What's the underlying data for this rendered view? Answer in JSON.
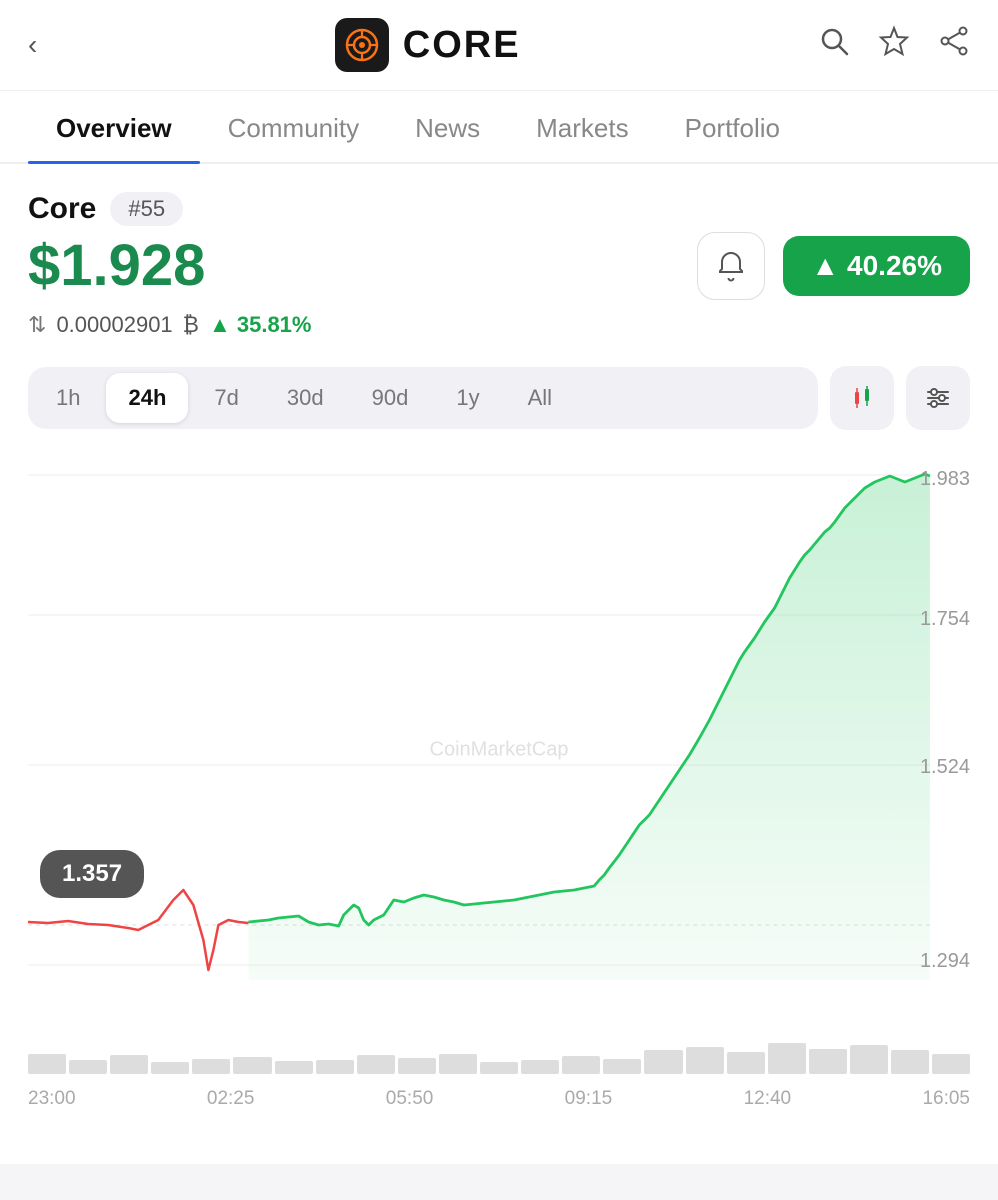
{
  "header": {
    "back_label": "‹",
    "logo_alt": "Core logo",
    "title": "CORE",
    "search_icon": "search",
    "star_icon": "star",
    "share_icon": "share"
  },
  "nav": {
    "tabs": [
      {
        "label": "Overview",
        "active": true
      },
      {
        "label": "Community",
        "active": false
      },
      {
        "label": "News",
        "active": false
      },
      {
        "label": "Markets",
        "active": false
      },
      {
        "label": "Portfolio",
        "active": false
      }
    ]
  },
  "coin": {
    "name": "Core",
    "rank": "#55",
    "price": "$1.928",
    "change_24h": "▲ 40.26%",
    "btc_price": "0.00002901",
    "btc_symbol": "₿",
    "btc_change": "▲ 35.81%"
  },
  "time_filters": [
    "1h",
    "24h",
    "7d",
    "30d",
    "90d",
    "1y",
    "All"
  ],
  "active_filter": "24h",
  "chart": {
    "y_labels": [
      "1.983",
      "1.754",
      "1.524",
      "1.294"
    ],
    "x_labels": [
      "23:00",
      "02:25",
      "05:50",
      "09:15",
      "12:40",
      "16:05"
    ],
    "tooltip": "1.357",
    "watermark": "CoinMarketCap"
  },
  "colors": {
    "green": "#16a34a",
    "green_line": "#22c55e",
    "green_fill": "rgba(34,197,94,0.18)",
    "red": "#ef4444",
    "accent_blue": "#2563eb"
  }
}
